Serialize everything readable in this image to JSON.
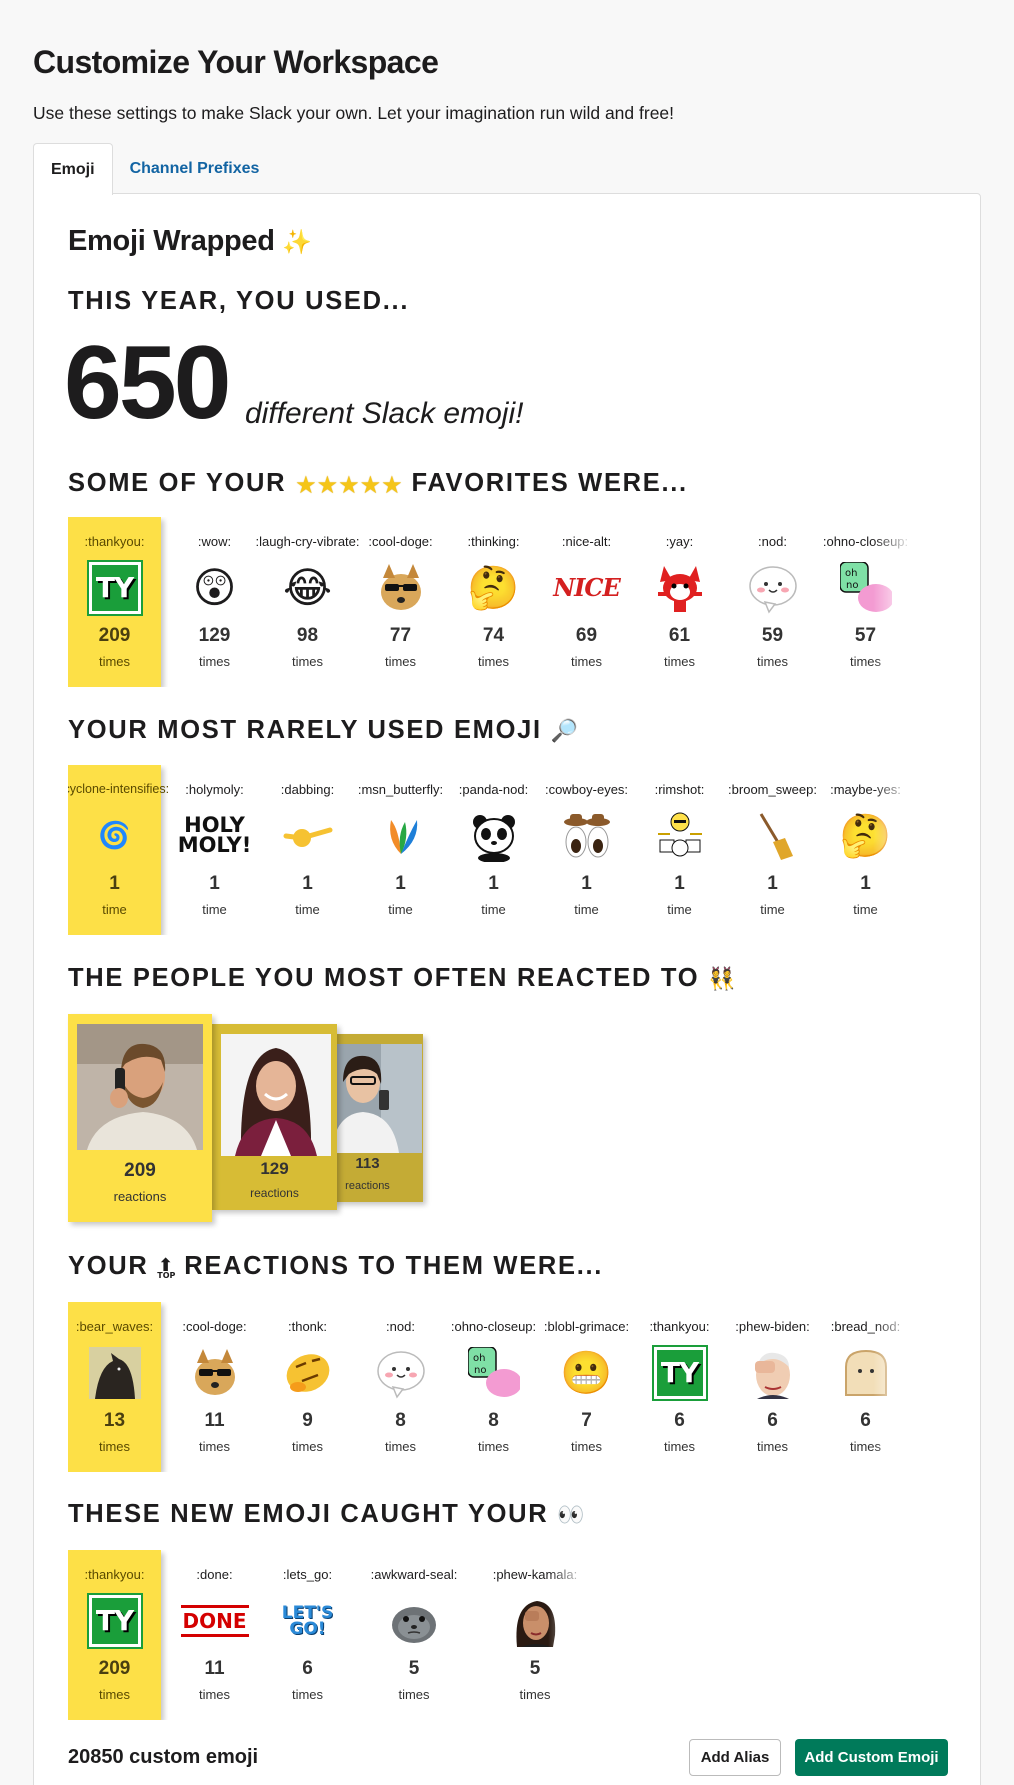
{
  "header": {
    "title": "Customize Your Workspace",
    "subtitle": "Use these settings to make Slack your own. Let your imagination run wild and free!"
  },
  "tabs": [
    {
      "label": "Emoji",
      "active": true
    },
    {
      "label": "Channel Prefixes",
      "active": false
    }
  ],
  "wrapped": {
    "title": "Emoji Wrapped",
    "title_icon": "sparkles-icon",
    "used_heading": "THIS YEAR, YOU USED...",
    "used_count": "650",
    "used_text": "different Slack emoji!"
  },
  "favorites": {
    "heading_before": "SOME OF YOUR",
    "heading_icon": "five-stars-icon",
    "heading_after": "FAVORITES WERE...",
    "items": [
      {
        "name": ":thankyou:",
        "count": "209",
        "unit": "times",
        "icon": "ty-icon"
      },
      {
        "name": ":wow:",
        "count": "129",
        "unit": "times",
        "icon": "astonished-face-icon"
      },
      {
        "name": ":laugh-cry-vibrate:",
        "count": "98",
        "unit": "times",
        "icon": "laughing-crying-face-icon"
      },
      {
        "name": ":cool-doge:",
        "count": "77",
        "unit": "times",
        "icon": "doge-sunglasses-icon"
      },
      {
        "name": ":thinking:",
        "count": "74",
        "unit": "times",
        "icon": "thinking-face-icon"
      },
      {
        "name": ":nice-alt:",
        "count": "69",
        "unit": "times",
        "icon": "nice-text-icon"
      },
      {
        "name": ":yay:",
        "count": "61",
        "unit": "times",
        "icon": "yay-fox-icon"
      },
      {
        "name": ":nod:",
        "count": "59",
        "unit": "times",
        "icon": "nod-bubble-icon"
      },
      {
        "name": ":ohno-closeup:",
        "count": "57",
        "unit": "times",
        "icon": "ohno-closeup-icon"
      }
    ]
  },
  "rare": {
    "heading": "YOUR MOST RARELY USED EMOJI",
    "heading_icon": "magnifying-glass-icon",
    "items": [
      {
        "name": ":cyclone-intensifies:",
        "count": "1",
        "unit": "time",
        "icon": "cyclone-icon"
      },
      {
        "name": ":holymoly:",
        "count": "1",
        "unit": "time",
        "icon": "holy-moly-text-icon",
        "text": "HOLY MOLY!"
      },
      {
        "name": ":dabbing:",
        "count": "1",
        "unit": "time",
        "icon": "dabbing-face-icon"
      },
      {
        "name": ":msn_butterfly:",
        "count": "1",
        "unit": "time",
        "icon": "msn-butterfly-icon"
      },
      {
        "name": ":panda-nod:",
        "count": "1",
        "unit": "time",
        "icon": "panda-icon"
      },
      {
        "name": ":cowboy-eyes:",
        "count": "1",
        "unit": "time",
        "icon": "cowboy-eyes-icon"
      },
      {
        "name": ":rimshot:",
        "count": "1",
        "unit": "time",
        "icon": "drummer-icon"
      },
      {
        "name": ":broom_sweep:",
        "count": "1",
        "unit": "time",
        "icon": "broom-icon"
      },
      {
        "name": ":maybe-yes:",
        "count": "1",
        "unit": "time",
        "icon": "party-thinking-face-icon"
      }
    ]
  },
  "people": {
    "heading": "THE PEOPLE YOU MOST OFTEN REACTED TO",
    "heading_icon": "two-people-icon",
    "items": [
      {
        "count": "209",
        "unit": "reactions",
        "photo": "man-on-phone-photo"
      },
      {
        "count": "129",
        "unit": "reactions",
        "photo": "smiling-woman-photo"
      },
      {
        "count": "113",
        "unit": "reactions",
        "photo": "woman-with-phone-photo"
      }
    ]
  },
  "reactions": {
    "heading_before": "YOUR",
    "heading_icon": "top-arrow-icon",
    "heading_after": "REACTIONS TO THEM WERE...",
    "items": [
      {
        "name": ":bear_waves:",
        "count": "13",
        "unit": "times",
        "icon": "bear-waves-icon"
      },
      {
        "name": ":cool-doge:",
        "count": "11",
        "unit": "times",
        "icon": "doge-sunglasses-icon"
      },
      {
        "name": ":thonk:",
        "count": "9",
        "unit": "times",
        "icon": "thonk-face-icon"
      },
      {
        "name": ":nod:",
        "count": "8",
        "unit": "times",
        "icon": "nod-bubble-icon"
      },
      {
        "name": ":ohno-closeup:",
        "count": "8",
        "unit": "times",
        "icon": "ohno-closeup-icon"
      },
      {
        "name": ":blobl-grimace:",
        "count": "7",
        "unit": "times",
        "icon": "grimacing-face-icon"
      },
      {
        "name": ":thankyou:",
        "count": "6",
        "unit": "times",
        "icon": "ty-icon"
      },
      {
        "name": ":phew-biden:",
        "count": "6",
        "unit": "times",
        "icon": "phew-biden-icon"
      },
      {
        "name": ":bread_nod:",
        "count": "6",
        "unit": "times",
        "icon": "bread-icon"
      }
    ]
  },
  "new_emoji": {
    "heading": "THESE NEW EMOJI CAUGHT YOUR",
    "heading_icon": "eyes-icon",
    "items": [
      {
        "name": ":thankyou:",
        "count": "209",
        "unit": "times",
        "icon": "ty-icon"
      },
      {
        "name": ":done:",
        "count": "11",
        "unit": "times",
        "icon": "done-text-icon",
        "text": "DONE"
      },
      {
        "name": ":lets_go:",
        "count": "6",
        "unit": "times",
        "icon": "lets-go-text-icon",
        "text": "LET'S GO!"
      },
      {
        "name": ":awkward-seal:",
        "count": "5",
        "unit": "times",
        "icon": "awkward-seal-icon"
      },
      {
        "name": ":phew-kamala:",
        "count": "5",
        "unit": "times",
        "icon": "phew-kamala-icon"
      }
    ]
  },
  "footer": {
    "custom_count": "20850 custom emoji",
    "add_alias_label": "Add Alias",
    "add_custom_label": "Add Custom Emoji"
  },
  "colors": {
    "highlight": "#fde047",
    "accent_green": "#007a5a",
    "link_blue": "#1264a3"
  }
}
